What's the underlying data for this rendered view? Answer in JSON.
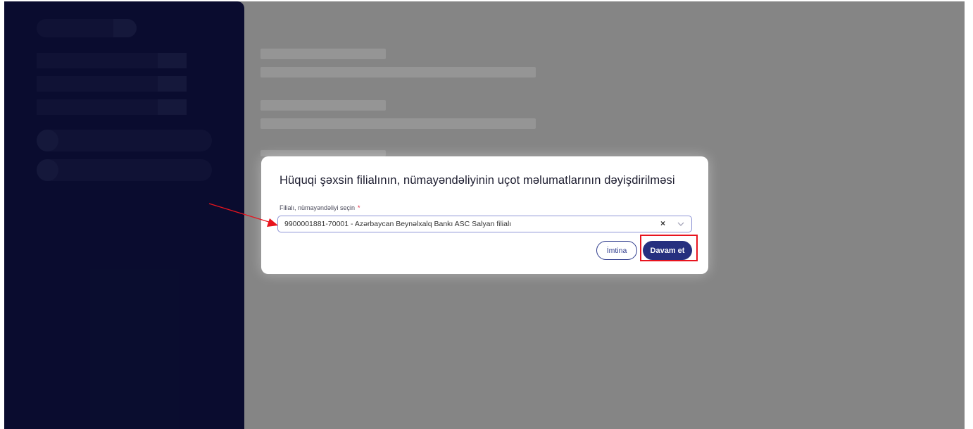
{
  "modal": {
    "title": "Hüquqi şəxsin filialının, nümayəndəliyinin uçot məlumatlarının dəyişdirilməsi",
    "field_label": "Filialı, nümayəndəliyi seçin",
    "required_mark": "*",
    "selected_value": "9900001881-70001 - Azərbaycan Beynəlxalq Bankı ASC Salyan filialı",
    "clear_symbol": "×",
    "cancel_label": "İmtina",
    "continue_label": "Davam et"
  },
  "colors": {
    "sidebar": "#14185a",
    "primary_button": "#26307f",
    "annotation": "#e8141e",
    "required": "#e0203a"
  },
  "icons": {
    "clear": "close-icon",
    "dropdown": "chevron-down-icon"
  }
}
